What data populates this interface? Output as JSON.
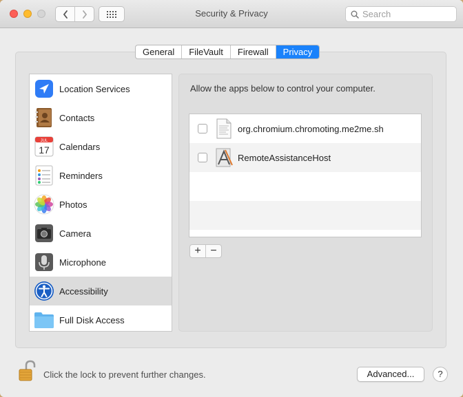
{
  "window": {
    "title": "Security & Privacy",
    "search_placeholder": "Search"
  },
  "tabs": [
    {
      "label": "General",
      "active": false
    },
    {
      "label": "FileVault",
      "active": false
    },
    {
      "label": "Firewall",
      "active": false
    },
    {
      "label": "Privacy",
      "active": true
    }
  ],
  "sidebar": {
    "items": [
      {
        "label": "Location Services",
        "icon": "location-arrow-icon"
      },
      {
        "label": "Contacts",
        "icon": "contacts-book-icon"
      },
      {
        "label": "Calendars",
        "icon": "calendar-icon",
        "icon_text": "17",
        "icon_month": "JUL"
      },
      {
        "label": "Reminders",
        "icon": "reminders-list-icon"
      },
      {
        "label": "Photos",
        "icon": "photos-flower-icon"
      },
      {
        "label": "Camera",
        "icon": "camera-icon"
      },
      {
        "label": "Microphone",
        "icon": "microphone-icon"
      },
      {
        "label": "Accessibility",
        "icon": "accessibility-icon",
        "selected": true
      },
      {
        "label": "Full Disk Access",
        "icon": "folder-icon"
      }
    ]
  },
  "main": {
    "description": "Allow the apps below to control your computer.",
    "apps": [
      {
        "name": "org.chromium.chromoting.me2me.sh",
        "checked": false,
        "icon": "script-document-icon"
      },
      {
        "name": "RemoteAssistanceHost",
        "checked": false,
        "icon": "application-icon"
      }
    ],
    "add_label": "+",
    "remove_label": "−"
  },
  "footer": {
    "lock_text": "Click the lock to prevent further changes.",
    "advanced_label": "Advanced...",
    "help_label": "?"
  },
  "colors": {
    "accent": "#1a82fb",
    "desktop": "#c9a36e",
    "window_bg": "#ececec"
  }
}
